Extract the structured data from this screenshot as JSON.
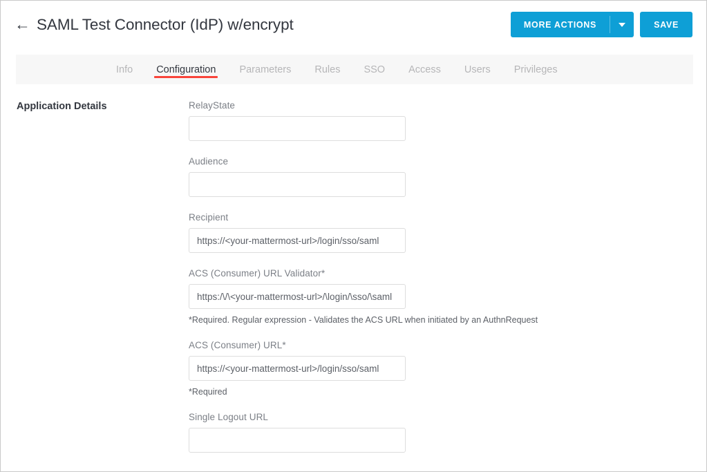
{
  "header": {
    "back_icon": "left-arrow-icon",
    "title": "SAML Test Connector (IdP) w/encrypt",
    "more_actions_label": "MORE ACTIONS",
    "more_actions_caret_icon": "chevron-down-icon",
    "save_label": "SAVE",
    "accent_color": "#0e9fd6"
  },
  "tabs": {
    "active_color": "#f9443a",
    "items": [
      {
        "label": "Info",
        "active": false
      },
      {
        "label": "Configuration",
        "active": true
      },
      {
        "label": "Parameters",
        "active": false
      },
      {
        "label": "Rules",
        "active": false
      },
      {
        "label": "SSO",
        "active": false
      },
      {
        "label": "Access",
        "active": false
      },
      {
        "label": "Users",
        "active": false
      },
      {
        "label": "Privileges",
        "active": false
      }
    ]
  },
  "main": {
    "section_label": "Application Details",
    "fields": [
      {
        "label": "RelayState",
        "value": "",
        "help": ""
      },
      {
        "label": "Audience",
        "value": "",
        "help": ""
      },
      {
        "label": "Recipient",
        "value": "https://<your-mattermost-url>/login/sso/saml",
        "help": ""
      },
      {
        "label": "ACS (Consumer) URL Validator*",
        "value": "https:/\\/\\<your-mattermost-url>/\\login/\\sso/\\saml",
        "help": "*Required. Regular expression - Validates the ACS URL when initiated by an AuthnRequest"
      },
      {
        "label": "ACS (Consumer) URL*",
        "value": "https://<your-mattermost-url>/login/sso/saml",
        "help": "*Required"
      },
      {
        "label": "Single Logout URL",
        "value": "",
        "help": ""
      }
    ]
  }
}
